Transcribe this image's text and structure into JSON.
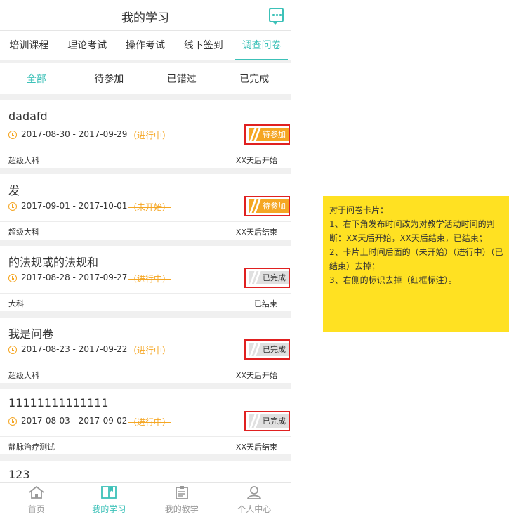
{
  "header": {
    "title": "我的学习"
  },
  "tabs": [
    {
      "label": "培训课程",
      "active": false
    },
    {
      "label": "理论考试",
      "active": false
    },
    {
      "label": "操作考试",
      "active": false
    },
    {
      "label": "线下签到",
      "active": false
    },
    {
      "label": "调查问卷",
      "active": true
    }
  ],
  "subtabs": [
    {
      "label": "全部",
      "active": true
    },
    {
      "label": "待参加",
      "active": false
    },
    {
      "label": "已错过",
      "active": false
    },
    {
      "label": "已完成",
      "active": false
    }
  ],
  "cards": [
    {
      "name": "dadafd",
      "dates": "2017-08-30 - 2017-09-29",
      "status": "（进行中）",
      "badge": "待参加",
      "badge_type": "join",
      "category": "超级大科",
      "timing": "XX天后开始"
    },
    {
      "name": "发",
      "dates": "2017-09-01 - 2017-10-01",
      "status": "（未开始）",
      "badge": "待参加",
      "badge_type": "join",
      "category": "超级大科",
      "timing": "XX天后结束"
    },
    {
      "name": "的法规或的法规和",
      "dates": "2017-08-28 - 2017-09-27",
      "status": "（进行中）",
      "badge": "已完成",
      "badge_type": "done",
      "category": "大科",
      "timing": "已结束"
    },
    {
      "name": "我是问卷",
      "dates": "2017-08-23 - 2017-09-22",
      "status": "（进行中）",
      "badge": "已完成",
      "badge_type": "done",
      "category": "超级大科",
      "timing": "XX天后开始"
    },
    {
      "name": "11111111111111",
      "dates": "2017-08-03 - 2017-09-02",
      "status": "（进行中）",
      "badge": "已完成",
      "badge_type": "done",
      "category": "静脉治疗测试",
      "timing": "XX天后结束"
    },
    {
      "name": "123"
    }
  ],
  "bottom_nav": [
    {
      "label": "首页",
      "icon": "home-icon",
      "active": false
    },
    {
      "label": "我的学习",
      "icon": "book-icon",
      "active": true
    },
    {
      "label": "我的教学",
      "icon": "clipboard-icon",
      "active": false
    },
    {
      "label": "个人中心",
      "icon": "user-icon",
      "active": false
    }
  ],
  "note": {
    "lines": [
      "对于问卷卡片：",
      "1、右下角发布时间改为对教学活动时间的判断：XX天后开始，XX天后结束，已结束；",
      "2、卡片上时间后面的（未开始）（进行中）（已结束）去掉；",
      "3、右侧的标识去掉（红框标注）。"
    ]
  },
  "colors": {
    "accent": "#3cc1b8",
    "orange": "#f5a623",
    "note_bg": "#ffe122",
    "highlight_border": "#e02020"
  }
}
